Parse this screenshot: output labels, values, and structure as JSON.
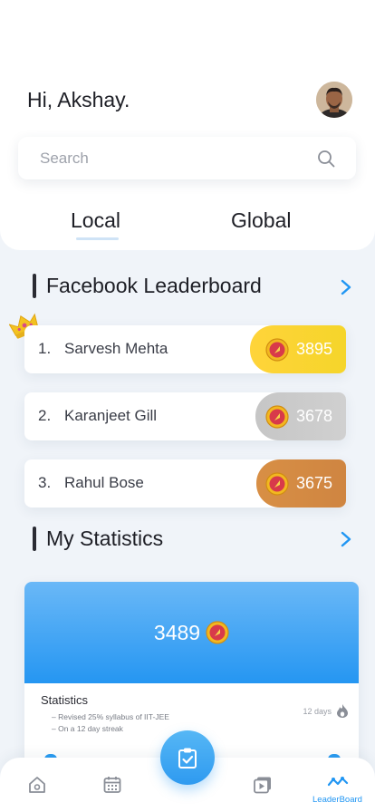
{
  "greeting": "Hi, Akshay.",
  "search": {
    "placeholder": "Search"
  },
  "tabs": [
    {
      "label": "Local",
      "active": true
    },
    {
      "label": "Global",
      "active": false
    }
  ],
  "leaderboard": {
    "title": "Facebook Leaderboard",
    "entries": [
      {
        "rank": "1.",
        "name": "Sarvesh Mehta",
        "score": "3895",
        "tier": "gold"
      },
      {
        "rank": "2.",
        "name": "Karanjeet Gill",
        "score": "3678",
        "tier": "silver"
      },
      {
        "rank": "3.",
        "name": "Rahul Bose",
        "score": "3675",
        "tier": "bronze"
      }
    ]
  },
  "statistics": {
    "title": "My Statistics",
    "value": "3489",
    "label": "Statistics",
    "notes": [
      "– Revised 25% syllabus of IIT-JEE",
      "– On a 12 day streak"
    ],
    "streak": "12 days"
  },
  "bottom_nav": {
    "items": [
      "home-icon",
      "calendar-icon",
      "video-play-icon",
      "leaderboard-icon"
    ],
    "active_label": "LeaderBoard"
  },
  "colors": {
    "accent": "#2196f3",
    "gold": "#ffd43a",
    "silver": "#c6c6c6",
    "bronze": "#d88f45"
  }
}
